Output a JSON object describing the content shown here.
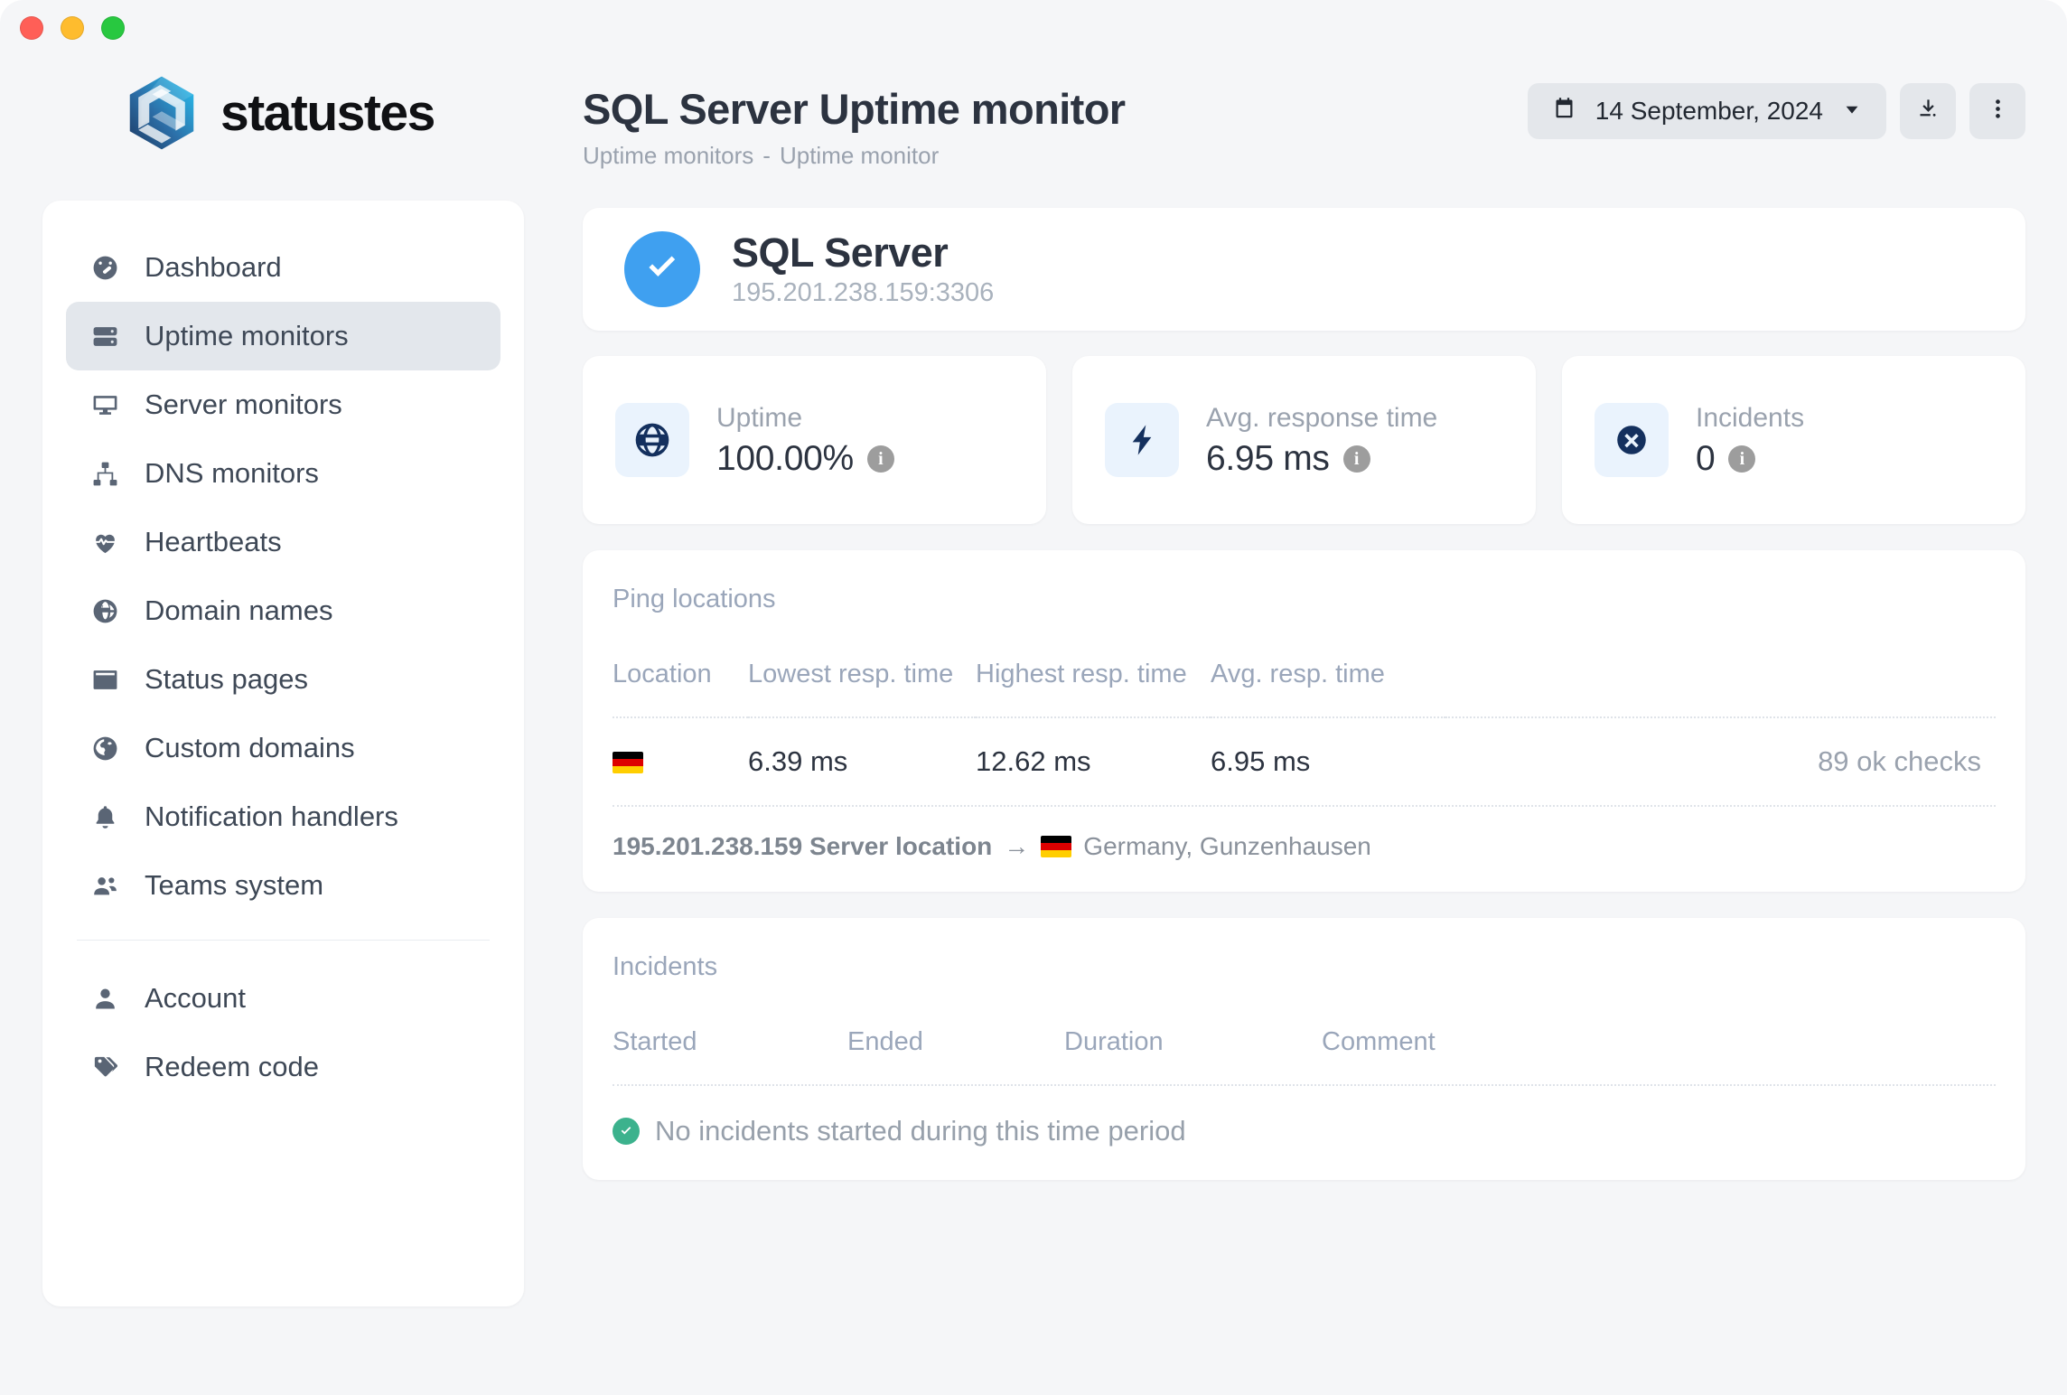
{
  "window": {
    "traffic_lights": [
      {
        "name": "close",
        "color": "#ff5f57"
      },
      {
        "name": "minimize",
        "color": "#febc2e"
      },
      {
        "name": "maximize",
        "color": "#28c840"
      }
    ]
  },
  "brand": {
    "name": "statustes",
    "logo_icon": "hexagon-swirl-logo"
  },
  "sidebar": {
    "items": [
      {
        "label": "Dashboard",
        "icon": "gauge-icon",
        "active": false
      },
      {
        "label": "Uptime monitors",
        "icon": "server-icon",
        "active": true
      },
      {
        "label": "Server monitors",
        "icon": "desktop-icon",
        "active": false
      },
      {
        "label": "DNS monitors",
        "icon": "sitemap-icon",
        "active": false
      },
      {
        "label": "Heartbeats",
        "icon": "heart-pulse-icon",
        "active": false
      },
      {
        "label": "Domain names",
        "icon": "globe-grid-icon",
        "active": false
      },
      {
        "label": "Status pages",
        "icon": "window-icon",
        "active": false
      },
      {
        "label": "Custom domains",
        "icon": "earth-icon",
        "active": false
      },
      {
        "label": "Notification handlers",
        "icon": "bell-icon",
        "active": false
      },
      {
        "label": "Teams system",
        "icon": "users-icon",
        "active": false
      }
    ],
    "footer_items": [
      {
        "label": "Account",
        "icon": "user-icon"
      },
      {
        "label": "Redeem code",
        "icon": "tag-icon"
      }
    ]
  },
  "header": {
    "title": "SQL Server Uptime monitor",
    "breadcrumb": {
      "parent": "Uptime monitors",
      "separator": "-",
      "current": "Uptime monitor"
    },
    "date_picker": {
      "icon": "calendar-icon",
      "value": "14 September, 2024",
      "chevron": "chevron-down-icon"
    },
    "download_button": {
      "icon": "download-icon"
    },
    "more_button": {
      "icon": "kebab-menu-icon"
    }
  },
  "monitor": {
    "status_icon": "check-circle-icon",
    "status_color": "#3fa0f0",
    "name": "SQL Server",
    "host": "195.201.238.159:3306"
  },
  "stats": [
    {
      "label": "Uptime",
      "value": "100.00%",
      "icon": "globe-icon",
      "info": "i"
    },
    {
      "label": "Avg. response time",
      "value": "6.95 ms",
      "icon": "bolt-icon",
      "info": "i"
    },
    {
      "label": "Incidents",
      "value": "0",
      "icon": "x-circle-icon",
      "info": "i"
    }
  ],
  "ping_locations": {
    "title": "Ping locations",
    "columns": [
      "Location",
      "Lowest resp. time",
      "Highest resp. time",
      "Avg. resp. time",
      ""
    ],
    "rows": [
      {
        "flag": "germany-flag",
        "lowest": "6.39 ms",
        "highest": "12.62 ms",
        "avg": "6.95 ms",
        "checks": "89 ok checks"
      }
    ],
    "server_location": {
      "ip_label": "195.201.238.159 Server location",
      "arrow": "→",
      "flag": "germany-flag",
      "place": "Germany, Gunzenhausen"
    }
  },
  "incidents": {
    "title": "Incidents",
    "columns": [
      "Started",
      "Ended",
      "Duration",
      "Comment"
    ],
    "empty_message": "No incidents started during this time period",
    "empty_icon": "check-circle-small-icon"
  }
}
